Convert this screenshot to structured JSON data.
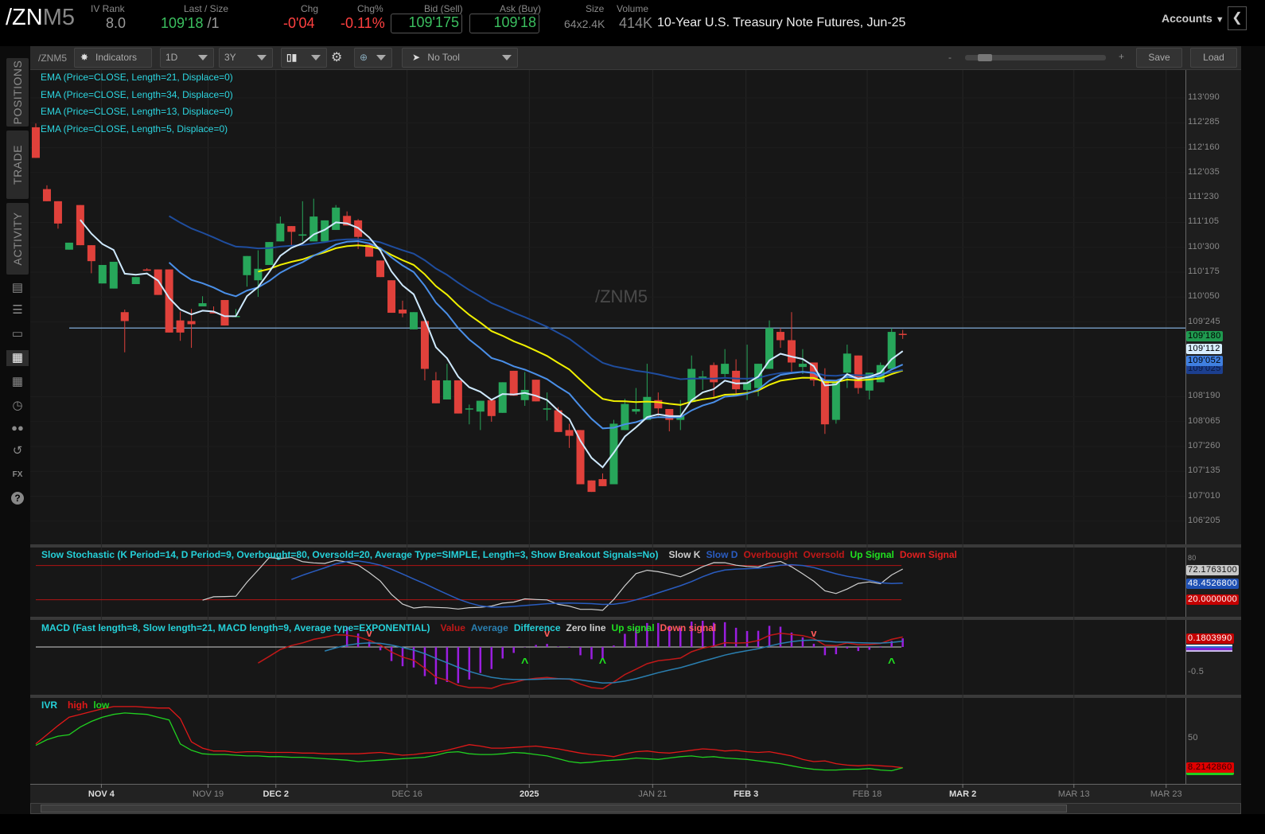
{
  "header": {
    "symbol_root": "/ZN",
    "symbol_month": "M5",
    "iv_rank": {
      "label": "IV Rank",
      "value": "8.0"
    },
    "last_size": {
      "label": "Last / Size",
      "value": "109'18",
      "size": "/1"
    },
    "chg": {
      "label": "Chg",
      "value": "-0'04"
    },
    "chg_pct": {
      "label": "Chg%",
      "value": "-0.11%"
    },
    "bid": {
      "label": "Bid (Sell)",
      "value": "109'175"
    },
    "ask": {
      "label": "Ask (Buy)",
      "value": "109'18"
    },
    "size": {
      "label": "Size",
      "value": "64x2.4K"
    },
    "volume": {
      "label": "Volume",
      "value": "414K"
    },
    "description": "10-Year U.S. Treasury Note Futures, Jun-25",
    "accounts_label": "Accounts"
  },
  "sidebar": {
    "tabs": [
      "POSITIONS",
      "TRADE",
      "ACTIVITY"
    ],
    "icons": [
      "news-icon",
      "list-icon",
      "tv-icon",
      "chart-icon",
      "grid-icon",
      "clock-icon",
      "community-icon",
      "transfer-icon",
      "fx-icon",
      "help-icon"
    ]
  },
  "toolbar": {
    "symbol": "/ZNM5",
    "indicators_label": "Indicators",
    "aggregation": "1D",
    "time_frame": "3Y",
    "drawing_tool": "No Tool",
    "zoom_minus": "-",
    "zoom_plus": "+",
    "zoom_level": 0.1,
    "save_label": "Save",
    "load_label": "Load"
  },
  "price_chart": {
    "watermark": "/ZNM5",
    "studies": [
      {
        "label": "EMA (Price=CLOSE, Length=21, Displace=0)",
        "length": 21,
        "color": "#f0f000",
        "start": 20
      },
      {
        "label": "EMA (Price=CLOSE, Length=34, Displace=0)",
        "length": 34,
        "color": "#1f4d9e",
        "start": 12
      },
      {
        "label": "EMA (Price=CLOSE, Length=13, Displace=0)",
        "length": 13,
        "color": "#4a8fe8",
        "start": 12
      },
      {
        "label": "EMA (Price=CLOSE, Length=5, Displace=0)",
        "length": 5,
        "color": "#cfeaff",
        "start": 4
      }
    ],
    "horizontal_line": 109.67,
    "price_ticks": [
      {
        "label": "113'090",
        "value": 113.28125
      },
      {
        "label": "112'285",
        "value": 112.890625
      },
      {
        "label": "112'160",
        "value": 112.5
      },
      {
        "label": "112'035",
        "value": 112.109375
      },
      {
        "label": "111'230",
        "value": 111.71875
      },
      {
        "label": "111'105",
        "value": 111.328125
      },
      {
        "label": "110'300",
        "value": 110.9375
      },
      {
        "label": "110'175",
        "value": 110.546875
      },
      {
        "label": "110'050",
        "value": 110.15625
      },
      {
        "label": "109'245",
        "value": 109.765625
      },
      {
        "label": "108'190",
        "value": 108.59375
      },
      {
        "label": "108'065",
        "value": 108.203125
      },
      {
        "label": "107'260",
        "value": 107.8125
      },
      {
        "label": "107'135",
        "value": 107.421875
      },
      {
        "label": "107'010",
        "value": 107.03125
      },
      {
        "label": "106'205",
        "value": 106.640625
      }
    ],
    "price_tags": [
      {
        "label": "109'180",
        "bg": "#1f9a4f",
        "fg": "#000000"
      },
      {
        "label": "109'112",
        "bg": "#d8eeff",
        "fg": "#000000"
      },
      {
        "label": "109'052",
        "bg": "#3f7fe0",
        "fg": "#000000"
      },
      {
        "label": "109'025",
        "bg": "#1c3f8f",
        "fg": "#0a1a40"
      }
    ]
  },
  "chart_data": {
    "type": "candlestick",
    "title": "/ZNM5",
    "ohlc": [
      [
        112.82,
        112.88,
        112.34,
        112.34
      ],
      [
        111.85,
        111.91,
        111.66,
        111.66
      ],
      [
        111.66,
        111.66,
        111.23,
        111.31
      ],
      [
        110.9,
        111.01,
        110.9,
        111.01
      ],
      [
        111.6,
        111.6,
        110.97,
        110.97
      ],
      [
        110.97,
        110.97,
        110.53,
        110.72
      ],
      [
        110.37,
        110.66,
        110.37,
        110.66
      ],
      [
        110.29,
        110.71,
        110.29,
        110.71
      ],
      [
        109.92,
        109.96,
        109.29,
        109.78
      ],
      [
        110.36,
        110.47,
        110.36,
        110.47
      ],
      [
        110.59,
        110.61,
        110.57,
        110.57
      ],
      [
        110.59,
        110.59,
        110.19,
        110.19
      ],
      [
        110.59,
        110.59,
        109.6,
        109.6
      ],
      [
        109.79,
        109.93,
        109.47,
        109.6
      ],
      [
        109.78,
        109.97,
        109.36,
        109.73
      ],
      [
        110.01,
        110.17,
        110.01,
        110.06
      ],
      [
        109.92,
        110.01,
        109.9,
        109.9
      ],
      [
        110.11,
        110.11,
        109.71,
        109.71
      ],
      [
        109.86,
        109.97,
        109.84,
        109.86
      ],
      [
        110.5,
        110.8,
        110.32,
        110.8
      ],
      [
        110.42,
        110.89,
        110.16,
        110.6
      ],
      [
        110.66,
        111.02,
        110.66,
        111.02
      ],
      [
        111.03,
        111.42,
        111.03,
        111.31
      ],
      [
        111.27,
        111.27,
        110.97,
        111.18
      ],
      [
        111.12,
        111.66,
        111.03,
        111.14
      ],
      [
        111.03,
        111.7,
        111.03,
        111.42
      ],
      [
        111.03,
        111.36,
        111.03,
        111.36
      ],
      [
        111.21,
        111.6,
        111.21,
        111.56
      ],
      [
        111.43,
        111.5,
        111.28,
        111.28
      ],
      [
        111.36,
        111.38,
        110.91,
        111.1
      ],
      [
        110.98,
        110.98,
        110.79,
        110.79
      ],
      [
        110.73,
        110.73,
        110.47,
        110.47
      ],
      [
        110.42,
        110.42,
        109.91,
        109.91
      ],
      [
        109.96,
        110.1,
        109.84,
        109.9
      ],
      [
        109.65,
        109.92,
        109.65,
        109.92
      ],
      [
        109.78,
        109.78,
        108.85,
        109.03
      ],
      [
        108.85,
        108.98,
        108.49,
        108.49
      ],
      [
        108.55,
        109.11,
        108.55,
        108.85
      ],
      [
        108.85,
        108.85,
        108.33,
        108.33
      ],
      [
        108.41,
        108.47,
        108.16,
        108.41
      ],
      [
        108.36,
        108.53,
        108.07,
        108.53
      ],
      [
        108.54,
        108.54,
        108.2,
        108.29
      ],
      [
        108.34,
        108.82,
        108.34,
        108.82
      ],
      [
        109.0,
        109.0,
        108.61,
        108.61
      ],
      [
        108.54,
        108.98,
        108.45,
        108.7
      ],
      [
        108.86,
        108.86,
        108.52,
        108.52
      ],
      [
        108.41,
        108.66,
        108.22,
        108.41
      ],
      [
        108.38,
        108.43,
        108.04,
        108.04
      ],
      [
        108.07,
        108.17,
        107.79,
        107.98
      ],
      [
        108.07,
        108.07,
        107.22,
        107.22
      ],
      [
        107.28,
        107.28,
        107.1,
        107.1
      ],
      [
        107.3,
        107.39,
        107.19,
        107.19
      ],
      [
        107.22,
        108.23,
        107.22,
        108.17
      ],
      [
        108.07,
        108.56,
        108.07,
        108.48
      ],
      [
        108.36,
        108.73,
        108.32,
        108.4
      ],
      [
        108.23,
        109.11,
        108.23,
        108.59
      ],
      [
        108.54,
        108.66,
        108.29,
        108.41
      ],
      [
        108.4,
        108.4,
        108.05,
        108.23
      ],
      [
        108.23,
        108.54,
        108.07,
        108.29
      ],
      [
        108.51,
        109.24,
        108.51,
        109.03
      ],
      [
        108.88,
        109.0,
        108.7,
        108.91
      ],
      [
        109.09,
        109.13,
        108.57,
        108.82
      ],
      [
        108.95,
        109.34,
        108.9,
        109.11
      ],
      [
        109.0,
        109.18,
        108.61,
        108.71
      ],
      [
        108.7,
        109.41,
        108.54,
        108.82
      ],
      [
        108.73,
        109.11,
        108.6,
        109.11
      ],
      [
        109.03,
        109.79,
        109.03,
        109.67
      ],
      [
        109.61,
        109.67,
        109.36,
        109.48
      ],
      [
        109.48,
        109.92,
        108.98,
        109.13
      ],
      [
        109.06,
        109.34,
        108.95,
        109.11
      ],
      [
        109.13,
        109.13,
        108.76,
        108.85
      ],
      [
        108.86,
        109.04,
        108.01,
        108.16
      ],
      [
        108.23,
        108.82,
        108.17,
        108.82
      ],
      [
        108.97,
        109.41,
        108.73,
        109.27
      ],
      [
        109.24,
        109.24,
        108.64,
        108.73
      ],
      [
        108.69,
        108.97,
        108.55,
        108.97
      ],
      [
        108.82,
        109.13,
        108.82,
        109.09
      ],
      [
        109.03,
        109.67,
        109.03,
        109.61
      ],
      [
        109.58,
        109.64,
        109.5,
        109.5625
      ]
    ],
    "ylim": [
      106.35,
      113.7
    ],
    "x_labels": [
      {
        "label": "NOV 4",
        "bar": 5.9,
        "bold": true
      },
      {
        "label": "NOV 19",
        "bar": 15.5,
        "bold": false
      },
      {
        "label": "DEC 2",
        "bar": 21.6,
        "bold": true
      },
      {
        "label": "DEC 16",
        "bar": 33.4,
        "bold": false
      },
      {
        "label": "2025",
        "bar": 44.4,
        "bold": true
      },
      {
        "label": "JAN 21",
        "bar": 55.5,
        "bold": false
      },
      {
        "label": "FEB 3",
        "bar": 63.9,
        "bold": true
      },
      {
        "label": "FEB 18",
        "bar": 74.8,
        "bold": false
      },
      {
        "label": "MAR 2",
        "bar": 83.4,
        "bold": true
      },
      {
        "label": "MAR 13",
        "bar": 93.4,
        "bold": false
      },
      {
        "label": "MAR 23",
        "bar": 101.7,
        "bold": false
      }
    ]
  },
  "stochastic": {
    "title": "Slow Stochastic (K Period=14, D Period=9, Overbought=80, Oversold=20, Average Type=SIMPLE, Length=3, Show Breakout Signals=No)",
    "legend": [
      {
        "label": "Slow K",
        "color": "#cfcfcf"
      },
      {
        "label": "Slow D",
        "color": "#2a5cc0"
      },
      {
        "label": "Overbought",
        "color": "#c01818"
      },
      {
        "label": "Oversold",
        "color": "#c01818"
      },
      {
        "label": "Up Signal",
        "color": "#20e020"
      },
      {
        "label": "Down Signal",
        "color": "#e02020"
      }
    ],
    "k_period": 14,
    "d_period": 9,
    "length": 3,
    "overbought": 80,
    "oversold": 20,
    "tags": [
      {
        "label": "72.1763100",
        "bg": "#c8c8c8",
        "fg": "#111"
      },
      {
        "label": "48.4526800",
        "bg": "#1e50b4",
        "fg": "#fff"
      },
      {
        "label": "20.0000000",
        "bg": "#c40000",
        "fg": "#fff"
      }
    ]
  },
  "macd": {
    "title": "MACD (Fast length=8, Slow length=21, MACD length=9, Average type=EXPONENTIAL)",
    "legend": [
      {
        "label": "Value",
        "color": "#c01818"
      },
      {
        "label": "Average",
        "color": "#2a7fb0"
      },
      {
        "label": "Difference",
        "color": "#25d0d8"
      },
      {
        "label": "Zero line",
        "color": "#cfcfcf"
      },
      {
        "label": "Up signal",
        "color": "#20e020"
      },
      {
        "label": "Down signal",
        "color": "#ff5a5a"
      }
    ],
    "fast": 8,
    "slow": 21,
    "signal": 9,
    "up_signals": [
      44,
      51,
      77
    ],
    "down_signals": [
      30,
      46,
      70
    ],
    "axis_label": "-0.5",
    "tag": {
      "label": "0.1803990",
      "bg": "#c40000",
      "fg": "#fff"
    }
  },
  "ivr": {
    "title": "IVR",
    "legend": [
      {
        "label": "high",
        "color": "#e01818"
      },
      {
        "label": "low",
        "color": "#20d020"
      }
    ],
    "axis_label": "50",
    "tag": {
      "label": "8.2142860",
      "bg": "#e00000",
      "fg": "#300"
    },
    "high": [
      42,
      55,
      68,
      80,
      84,
      88,
      92,
      95,
      95,
      95,
      94,
      93,
      93,
      78,
      45,
      36,
      32,
      32,
      30,
      31,
      31,
      30,
      30,
      30,
      29,
      29,
      28,
      28,
      28,
      28,
      29,
      30,
      28,
      26,
      27,
      29,
      30,
      33,
      37,
      41,
      39,
      36,
      36,
      37,
      38,
      39,
      37,
      35,
      32,
      29,
      27,
      26,
      24,
      28,
      31,
      32,
      30,
      29,
      31,
      33,
      35,
      34,
      32,
      33,
      31,
      30,
      31,
      28,
      25,
      20,
      17,
      18,
      14,
      12,
      11,
      12,
      11,
      10,
      8.2
    ],
    "low": [
      40,
      48,
      53,
      55,
      66,
      74,
      80,
      84,
      86,
      85,
      84,
      80,
      76,
      42,
      33,
      28,
      27,
      27,
      26,
      25,
      25,
      24,
      24,
      23,
      23,
      22,
      21,
      20,
      19,
      17,
      18,
      19,
      20,
      21,
      22,
      23,
      26,
      30,
      31,
      28,
      27,
      27,
      28,
      30,
      29,
      27,
      25,
      21,
      17,
      15,
      16,
      18,
      19,
      20,
      22,
      21,
      20,
      22,
      24,
      25,
      23,
      24,
      22,
      21,
      20,
      18,
      16,
      14,
      11,
      8,
      6,
      5,
      5,
      6,
      6,
      7,
      5,
      4,
      8.2
    ]
  }
}
